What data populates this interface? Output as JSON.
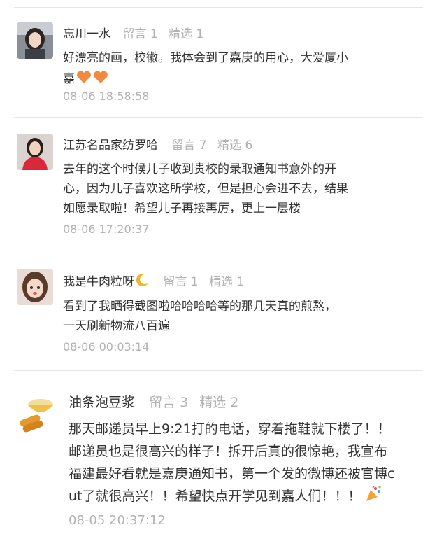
{
  "comments": [
    {
      "nickname": "忘川一水",
      "reply_label": "留言 1",
      "featured_label": "精选 1",
      "lines": [
        "好漂亮的画，校徽。我体会到了嘉庚的用心，大爱厦小",
        "嘉"
      ],
      "emoji": "heart-icon",
      "time": "08-06 18:58:58"
    },
    {
      "nickname": "江苏名品家纺罗哈",
      "reply_label": "留言 7",
      "featured_label": "精选 6",
      "lines": [
        "去年的这个时候儿子收到贵校的录取通知书意外的开",
        "心，因为儿子喜欢这所学校，但是担心会进不去，结果",
        "如愿录取啦！希望儿子再接再厉，更上一层楼"
      ],
      "time": "08-06 17:20:37"
    },
    {
      "nickname": "我是牛肉粒呀",
      "reply_label": "留言 1",
      "featured_label": "精选 1",
      "lines": [
        "看到了我晒得截图啦哈哈哈哈等的那几天真的煎熬，",
        "一天刷新物流八百遍"
      ],
      "emoji": "moon-icon",
      "time": "08-06 00:03:14"
    },
    {
      "nickname": "油条泡豆浆",
      "reply_label": "留言 3",
      "featured_label": "精选 2",
      "lines": [
        "那天邮递员早上9:21打的电话，穿着拖鞋就下楼了！！",
        "邮递员也是很高兴的样子！拆开后真的很惊艳，我宣布",
        "福建最好看就是嘉庚通知书，第一个发的微博还被官博c",
        "ut了就很高兴！！希望快点开学见到嘉人们！！！"
      ],
      "emoji": "party-popper-icon",
      "time": "08-05 20:37:12"
    }
  ]
}
